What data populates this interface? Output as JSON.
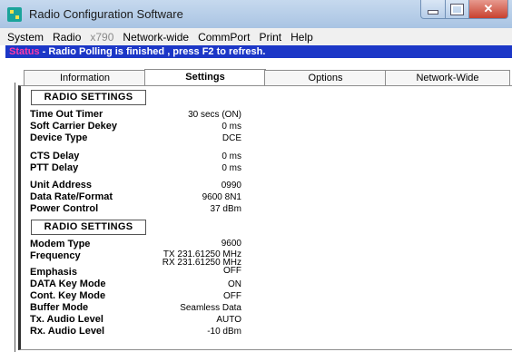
{
  "window": {
    "title": "Radio Configuration Software"
  },
  "menu": [
    "System",
    "Radio",
    "x790",
    "Network-wide",
    "CommPort",
    "Print",
    "Help"
  ],
  "status": {
    "label": "Status",
    "separator": " - ",
    "message": "Radio Polling is finished , press F2 to refresh."
  },
  "tabs": [
    "Information",
    "Settings",
    "Options",
    "Network-Wide"
  ],
  "active_tab": "Settings",
  "settings": {
    "section1_title": "RADIO SETTINGS",
    "section2_title": "RADIO SETTINGS",
    "timeout_timer": {
      "label": "Time Out Timer",
      "value": "30 secs (ON)"
    },
    "soft_carrier_dekey": {
      "label": "Soft Carrier Dekey",
      "value": "0 ms"
    },
    "device_type": {
      "label": "Device Type",
      "value": "DCE"
    },
    "cts_delay": {
      "label": "CTS Delay",
      "value": "0 ms"
    },
    "ptt_delay": {
      "label": "PTT Delay",
      "value": "0 ms"
    },
    "unit_address": {
      "label": "Unit Address",
      "value": "0990"
    },
    "data_rate": {
      "label": "Data Rate/Format",
      "value": "9600 8N1"
    },
    "power_control": {
      "label": "Power Control",
      "value": "37 dBm"
    },
    "modem_type": {
      "label": "Modem Type",
      "value": "9600"
    },
    "frequency": {
      "label": "Frequency",
      "tx": "TX 231.61250 MHz",
      "rx": "RX 231.61250 MHz"
    },
    "emphasis": {
      "label": "Emphasis",
      "value": "OFF"
    },
    "data_key_mode": {
      "label": "DATA Key Mode",
      "value": "ON"
    },
    "cont_key_mode": {
      "label": "Cont. Key Mode",
      "value": "OFF"
    },
    "buffer_mode": {
      "label": "Buffer Mode",
      "value": "Seamless Data"
    },
    "tx_audio_level": {
      "label": "Tx. Audio Level",
      "value": "AUTO"
    },
    "rx_audio_level": {
      "label": "Rx. Audio Level",
      "value": "-10 dBm"
    }
  }
}
